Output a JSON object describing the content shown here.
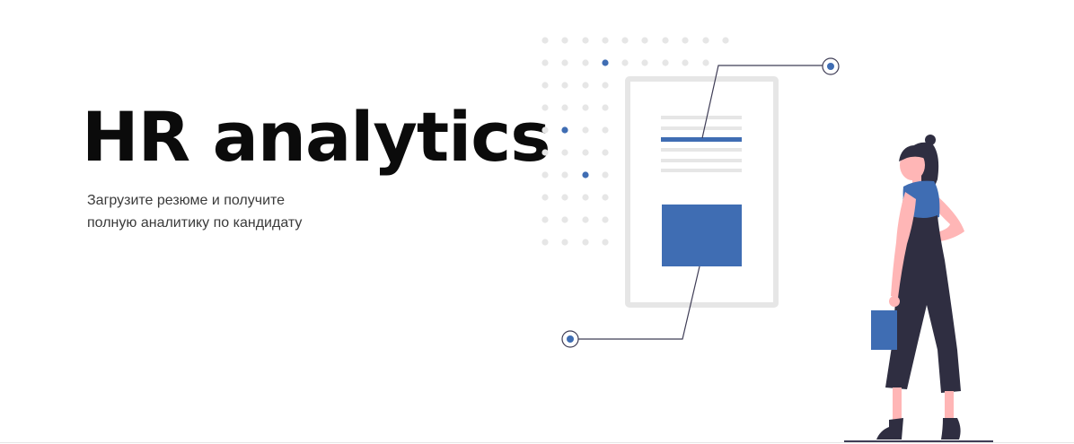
{
  "hero": {
    "title": "HR analytics",
    "subtitle_line1": "Загрузите резюме и получите",
    "subtitle_line2": "полную аналитику по кандидату"
  },
  "colors": {
    "accent": "#3f6db3",
    "dot_grey": "#e6e6e6",
    "document_frame": "#e6e6e6",
    "figure_dark": "#2f2e41",
    "skin": "#ffb6b6",
    "text": "#0b0b0b"
  },
  "illustration": {
    "subject": "resume-document-with-woman-holding-folder"
  }
}
